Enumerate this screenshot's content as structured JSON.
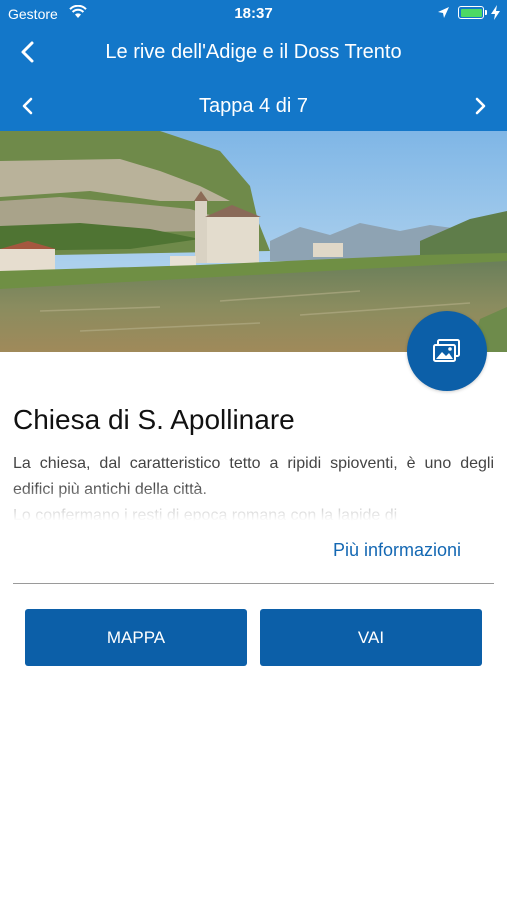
{
  "status_bar": {
    "carrier": "Gestore",
    "time": "18:37",
    "battery_color": "#4cd964"
  },
  "header": {
    "title": "Le rive dell'Adige e il Doss Trento",
    "stage_label": "Tappa 4 di 7",
    "background_color": "#1377c9",
    "back_icon": "chevron-left-icon",
    "prev_icon": "chevron-left-icon",
    "next_icon": "chevron-right-icon"
  },
  "hero": {
    "gallery_icon": "image-gallery-icon",
    "fab_color": "#0c5fa8"
  },
  "poi": {
    "title": "Chiesa di S. Apollinare",
    "description_visible": "La chiesa, dal caratteristico tetto a ripidi spioventi, è uno degli edifici più antichi della città.",
    "description_faded": "Lo confermano i resti di epoca romana con la lapide di",
    "more_label": "Più informazioni",
    "link_color": "#1468b3"
  },
  "actions": {
    "map_label": "MAPPA",
    "go_label": "VAI",
    "button_color": "#0c5fa8"
  }
}
